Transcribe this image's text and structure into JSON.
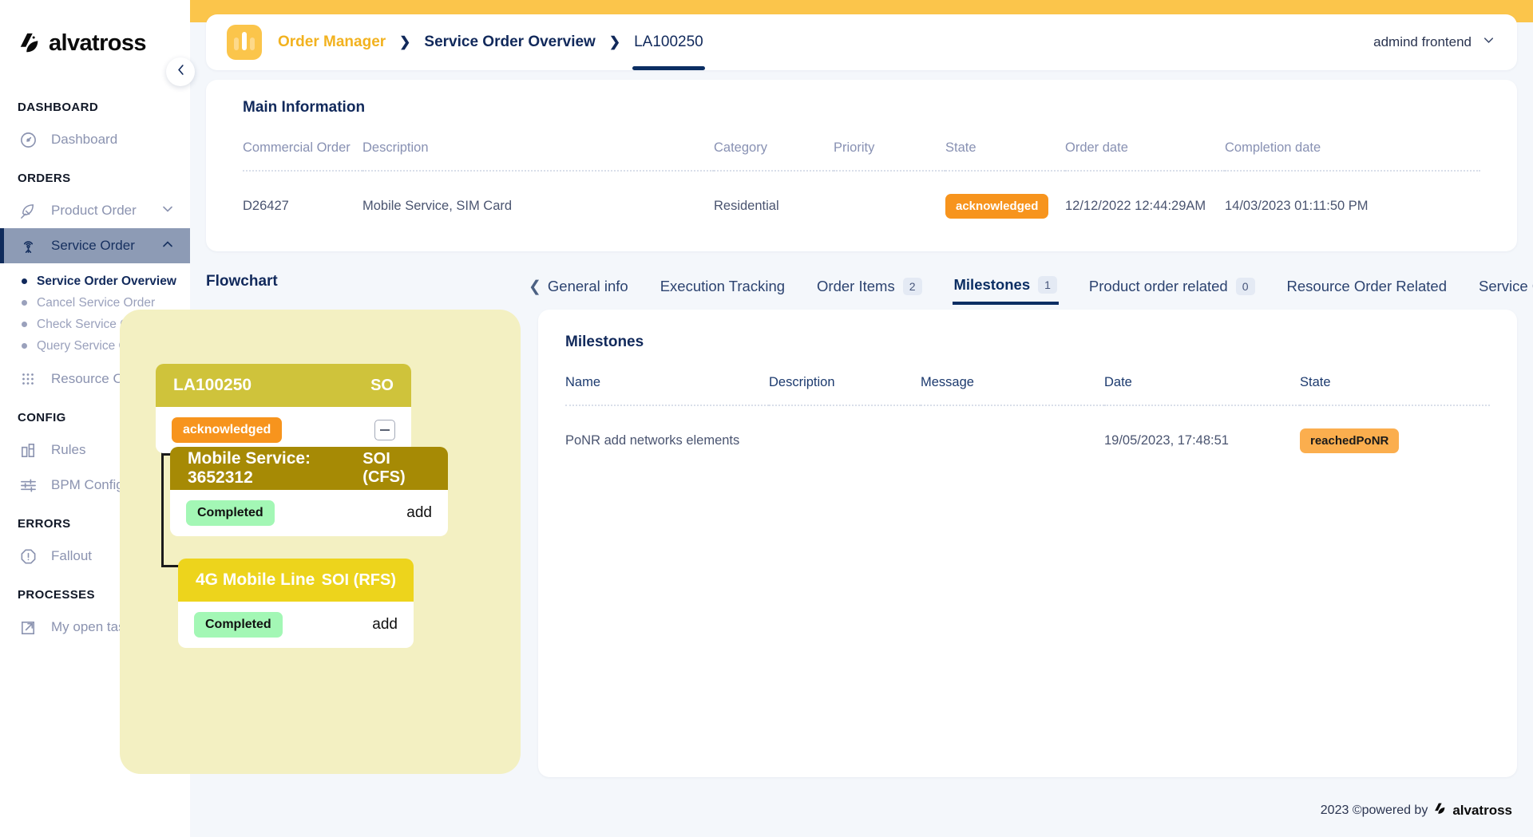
{
  "brand": {
    "name": "alvatross",
    "logo_icon": "alvatross-logo-icon"
  },
  "sidebar": {
    "collapse_icon": "chevron-left-icon",
    "sections": [
      {
        "title": "DASHBOARD",
        "items": [
          {
            "label": "Dashboard",
            "icon": "speedometer-icon",
            "active": false,
            "expandable": false
          }
        ]
      },
      {
        "title": "ORDERS",
        "items": [
          {
            "label": "Product Order",
            "icon": "rocket-icon",
            "active": false,
            "expandable": true,
            "chevron": "chevron-down-icon"
          },
          {
            "label": "Service Order",
            "icon": "antenna-icon",
            "active": true,
            "expandable": true,
            "chevron": "chevron-up-icon",
            "subitems": [
              {
                "label": "Service Order Overview",
                "current": true
              },
              {
                "label": "Cancel Service Order",
                "current": false
              },
              {
                "label": "Check Service Qua",
                "current": false
              },
              {
                "label": "Query Service Qua",
                "current": false
              }
            ]
          },
          {
            "label": "Resource Ord",
            "icon": "grid-dots-icon",
            "active": false,
            "expandable": false
          }
        ]
      },
      {
        "title": "CONFIG",
        "items": [
          {
            "label": "Rules",
            "icon": "bar-chart-icon",
            "active": false,
            "expandable": false
          },
          {
            "label": "BPM Config",
            "icon": "sliders-icon",
            "active": false,
            "expandable": false
          }
        ]
      },
      {
        "title": "ERRORS",
        "items": [
          {
            "label": "Fallout",
            "icon": "alert-octagon-icon",
            "active": false,
            "expandable": false
          }
        ]
      },
      {
        "title": "PROCESSES",
        "items": [
          {
            "label": "My open task",
            "icon": "external-link-icon",
            "active": false,
            "expandable": false
          }
        ]
      }
    ]
  },
  "header": {
    "app_icon": "order-manager-icon",
    "breadcrumb": [
      {
        "label": "Order Manager",
        "style": "brand"
      },
      {
        "label": "Service Order Overview",
        "style": "link"
      },
      {
        "label": "LA100250",
        "style": "current"
      }
    ],
    "separator_icon": "chevron-right-icon",
    "user": {
      "label": "admind frontend",
      "chevron": "chevron-down-icon"
    }
  },
  "main_information": {
    "title": "Main Information",
    "columns": [
      "Commercial Order",
      "Description",
      "Category",
      "Priority",
      "State",
      "Order date",
      "Completion date"
    ],
    "rows": [
      {
        "commercial_order": "D26427",
        "description": "Mobile Service, SIM Card",
        "category": "Residential",
        "priority": "",
        "state": "acknowledged",
        "order_date": "12/12/2022 12:44:29AM",
        "completion_date": "14/03/2023 01:11:50 PM"
      }
    ]
  },
  "flowchart": {
    "label": "Flowchart",
    "nodes": [
      {
        "title": "LA100250",
        "type": "SO",
        "status": "acknowledged",
        "status_color": "#F7941D",
        "header_color": "#CFC33B",
        "action": "",
        "collapse_icon": "minus-square-icon"
      },
      {
        "title": "Mobile Service: 3652312",
        "type": "SOI (CFS)",
        "status": "Completed",
        "status_color": "#A3F7B5",
        "header_color": "#A68A05",
        "action": "add"
      },
      {
        "title": "4G Mobile Line",
        "type": "SOI (RFS)",
        "status": "Completed",
        "status_color": "#A3F7B5",
        "header_color": "#EDD41C",
        "action": "add"
      }
    ]
  },
  "tabs": {
    "scroll_left_icon": "chevron-left-icon",
    "items": [
      {
        "label": "General info",
        "count": null,
        "active": false
      },
      {
        "label": "Execution Tracking",
        "count": null,
        "active": false
      },
      {
        "label": "Order Items",
        "count": "2",
        "active": false
      },
      {
        "label": "Milestones",
        "count": "1",
        "active": true
      },
      {
        "label": "Product order related",
        "count": "0",
        "active": false
      },
      {
        "label": "Resource Order Related",
        "count": null,
        "active": false
      },
      {
        "label": "Service Order Rela",
        "count": null,
        "active": false
      }
    ]
  },
  "milestones": {
    "title": "Milestones",
    "columns": [
      "Name",
      "Description",
      "Message",
      "Date",
      "State"
    ],
    "rows": [
      {
        "name": "PoNR add networks elements",
        "description": "",
        "message": "",
        "date": "19/05/2023, 17:48:51",
        "state": "reachedPoNR"
      }
    ]
  },
  "footer": {
    "text": "2023 ©powered by",
    "brand": "alvatross",
    "logo_icon": "alvatross-logo-icon"
  },
  "colors": {
    "accent_yellow": "#FBC54B",
    "navy": "#0B2E63",
    "orange": "#F7941D",
    "orange_light": "#FBAE4E",
    "green": "#A3F7B5",
    "sidebar_active": "#8D9BB5"
  }
}
